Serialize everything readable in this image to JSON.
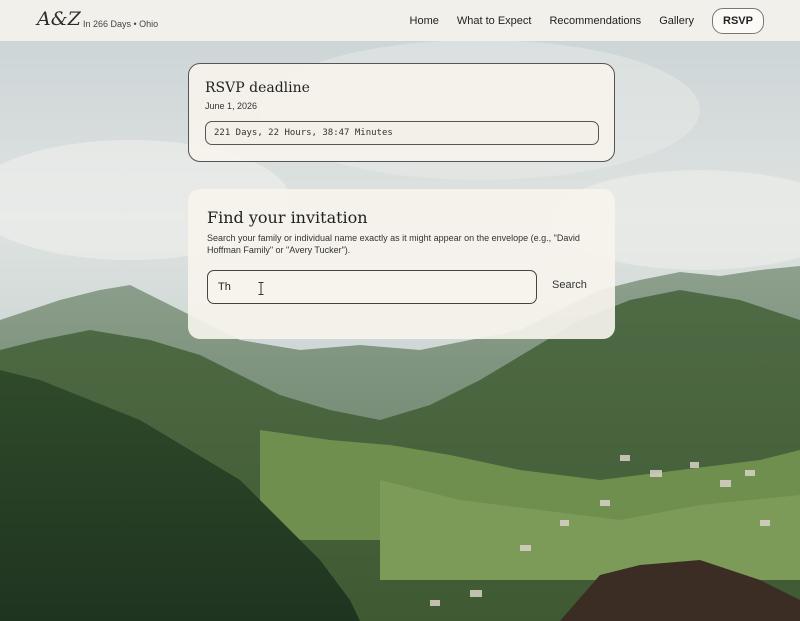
{
  "nav": {
    "logo": "A&Z",
    "tagline": "In 266 Days • Ohio",
    "items": [
      {
        "label": "Home"
      },
      {
        "label": "What to Expect"
      },
      {
        "label": "Recommendations"
      },
      {
        "label": "Gallery"
      }
    ],
    "rsvp_label": "RSVP"
  },
  "deadline": {
    "title": "RSVP deadline",
    "date": "June 1, 2026",
    "countdown": "221 Days, 22 Hours, 38:47 Minutes"
  },
  "finder": {
    "title": "Find your invitation",
    "description": "Search your family or individual name exactly as it might appear on the envelope (e.g., \"David Hoffman Family\" or \"Avery Tucker\").",
    "input_value": "Th",
    "search_label": "Search"
  },
  "colors": {
    "nav_bg": "#f4f2ec",
    "card_bg": "#f6f3ec",
    "text": "#222222"
  }
}
